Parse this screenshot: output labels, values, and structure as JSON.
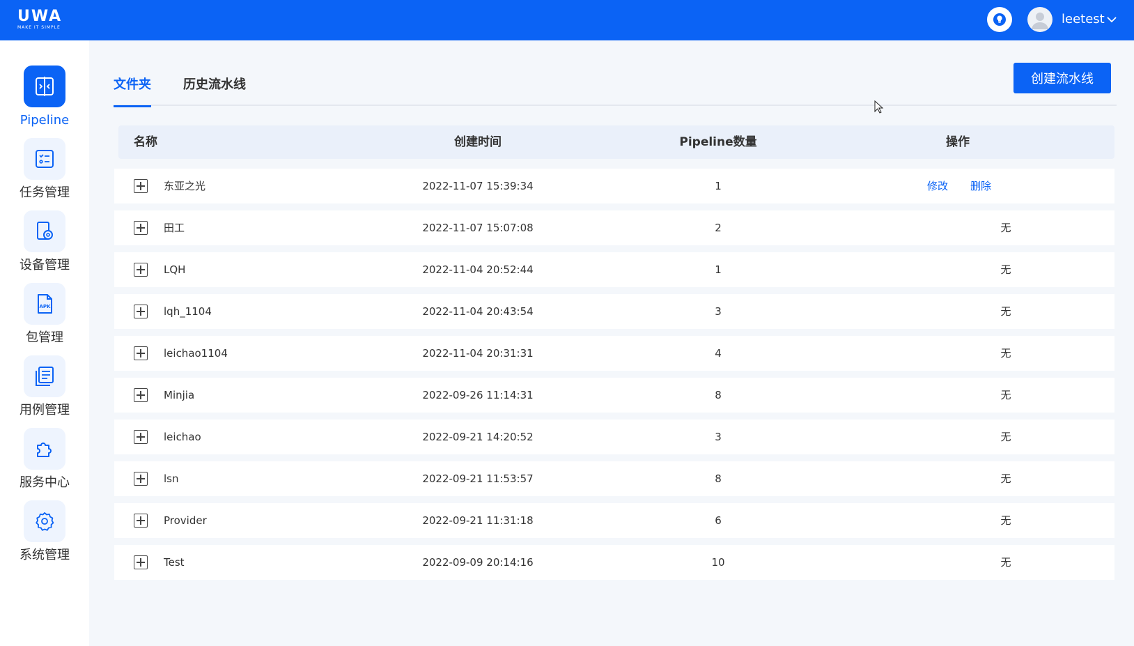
{
  "header": {
    "brand": "UWA",
    "slogan": "MAKE IT SIMPLE",
    "username": "leetest",
    "accent_color": "#0b63f5"
  },
  "sidebar": {
    "items": [
      {
        "label": "Pipeline",
        "icon": "pipeline-icon",
        "active": true
      },
      {
        "label": "任务管理",
        "icon": "task-list-icon",
        "active": false
      },
      {
        "label": "设备管理",
        "icon": "device-icon",
        "active": false
      },
      {
        "label": "包管理",
        "icon": "apk-file-icon",
        "active": false
      },
      {
        "label": "用例管理",
        "icon": "test-case-icon",
        "active": false
      },
      {
        "label": "服务中心",
        "icon": "puzzle-icon",
        "active": false
      },
      {
        "label": "系统管理",
        "icon": "gear-icon",
        "active": false
      }
    ]
  },
  "main": {
    "tabs": [
      {
        "label": "文件夹",
        "active": true
      },
      {
        "label": "历史流水线",
        "active": false
      }
    ],
    "create_button": "创建流水线",
    "table": {
      "columns": [
        "名称",
        "创建时间",
        "Pipeline数量",
        "操作"
      ],
      "rows": [
        {
          "name": "东亚之光",
          "created": "2022-11-07 15:39:34",
          "count": "1",
          "ops": [
            "修改",
            "删除"
          ]
        },
        {
          "name": "田工",
          "created": "2022-11-07 15:07:08",
          "count": "2",
          "op_text": "无"
        },
        {
          "name": "LQH",
          "created": "2022-11-04 20:52:44",
          "count": "1",
          "op_text": "无"
        },
        {
          "name": "lqh_1104",
          "created": "2022-11-04 20:43:54",
          "count": "3",
          "op_text": "无"
        },
        {
          "name": "leichao1104",
          "created": "2022-11-04 20:31:31",
          "count": "4",
          "op_text": "无"
        },
        {
          "name": "Minjia",
          "created": "2022-09-26 11:14:31",
          "count": "8",
          "op_text": "无"
        },
        {
          "name": "leichao",
          "created": "2022-09-21 14:20:52",
          "count": "3",
          "op_text": "无"
        },
        {
          "name": "lsn",
          "created": "2022-09-21 11:53:57",
          "count": "8",
          "op_text": "无"
        },
        {
          "name": "Provider",
          "created": "2022-09-21 11:31:18",
          "count": "6",
          "op_text": "无"
        },
        {
          "name": "Test",
          "created": "2022-09-09 20:14:16",
          "count": "10",
          "op_text": "无"
        }
      ]
    }
  }
}
